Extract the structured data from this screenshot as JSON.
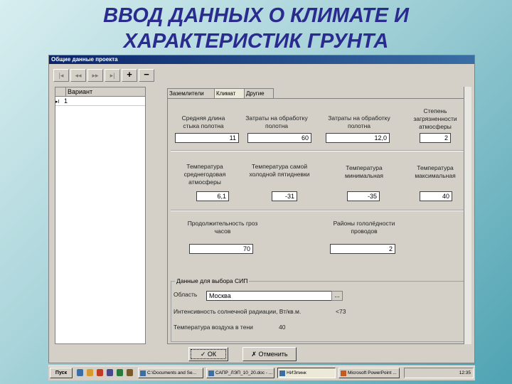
{
  "slide": {
    "title_line1": "ВВОД ДАННЫХ О КЛИМАТЕ И",
    "title_line2": "ХАРАКТЕРИСТИК ГРУНТА"
  },
  "window": {
    "title": "Общие данные проекта",
    "toolbar": {
      "first_label": "|◂",
      "prev_label": "◂◂",
      "next_label": "▸▸",
      "last_label": "▸|",
      "add_label": "+",
      "remove_label": "−"
    },
    "grid": {
      "header": "Вариант",
      "rows": [
        {
          "marker": "▸I",
          "value": "1"
        }
      ]
    },
    "tabs": [
      {
        "label": "Заземлители",
        "active": false
      },
      {
        "label": "Климат",
        "active": true
      },
      {
        "label": "Другие",
        "active": false
      }
    ],
    "fields": {
      "f1": {
        "label": "Средняя длина стыка полотна",
        "value": "11"
      },
      "f2": {
        "label": "Затраты на обработку полотна",
        "value": "60"
      },
      "f3": {
        "label": "Затраты на обработку полотна",
        "value": "12,0"
      },
      "f4": {
        "label": "Степень загрязненности атмосферы",
        "value": "2"
      },
      "f5": {
        "label": "Температура среднегодовая атмосферы",
        "value": "6,1"
      },
      "f6": {
        "label": "Температура самой холодной пятидневки",
        "value": "-31"
      },
      "f7": {
        "label": "Температура минимальная",
        "value": "-35"
      },
      "f8": {
        "label": "Температура максимальная",
        "value": "40"
      },
      "f9": {
        "label": "Продолжительность гроз часов",
        "value": "70"
      },
      "f10": {
        "label": "Районы гололёдности проводов",
        "value": "2"
      }
    },
    "group": {
      "title": "Данные для выбора СИП",
      "region_label": "Область",
      "region_value": "Москва",
      "combo_button": "...",
      "solar_label": "Интенсивность солнечной радиации, Вт/кв.м.",
      "solar_value": "<73",
      "air_temp_label": "Температура воздуха в тени",
      "air_temp_value": "40"
    },
    "ok_label": "✓ ОК",
    "cancel_label": "✗ Отменить"
  },
  "taskbar": {
    "start_label": "Пуск",
    "tasks": [
      {
        "label": "C:\\Documents and Se...",
        "active": false
      },
      {
        "label": "САПР_ЛЭП_10_20.doc - ...",
        "active": false
      },
      {
        "label": "НИЭлинк",
        "active": true
      },
      {
        "label": "Microsoft PowerPoint ...",
        "active": false
      }
    ],
    "tray_time": "12:35"
  },
  "colors": {
    "title": "#2b2b8f",
    "window_bg": "#d4d0c8",
    "titlebar": "#0a246a"
  }
}
